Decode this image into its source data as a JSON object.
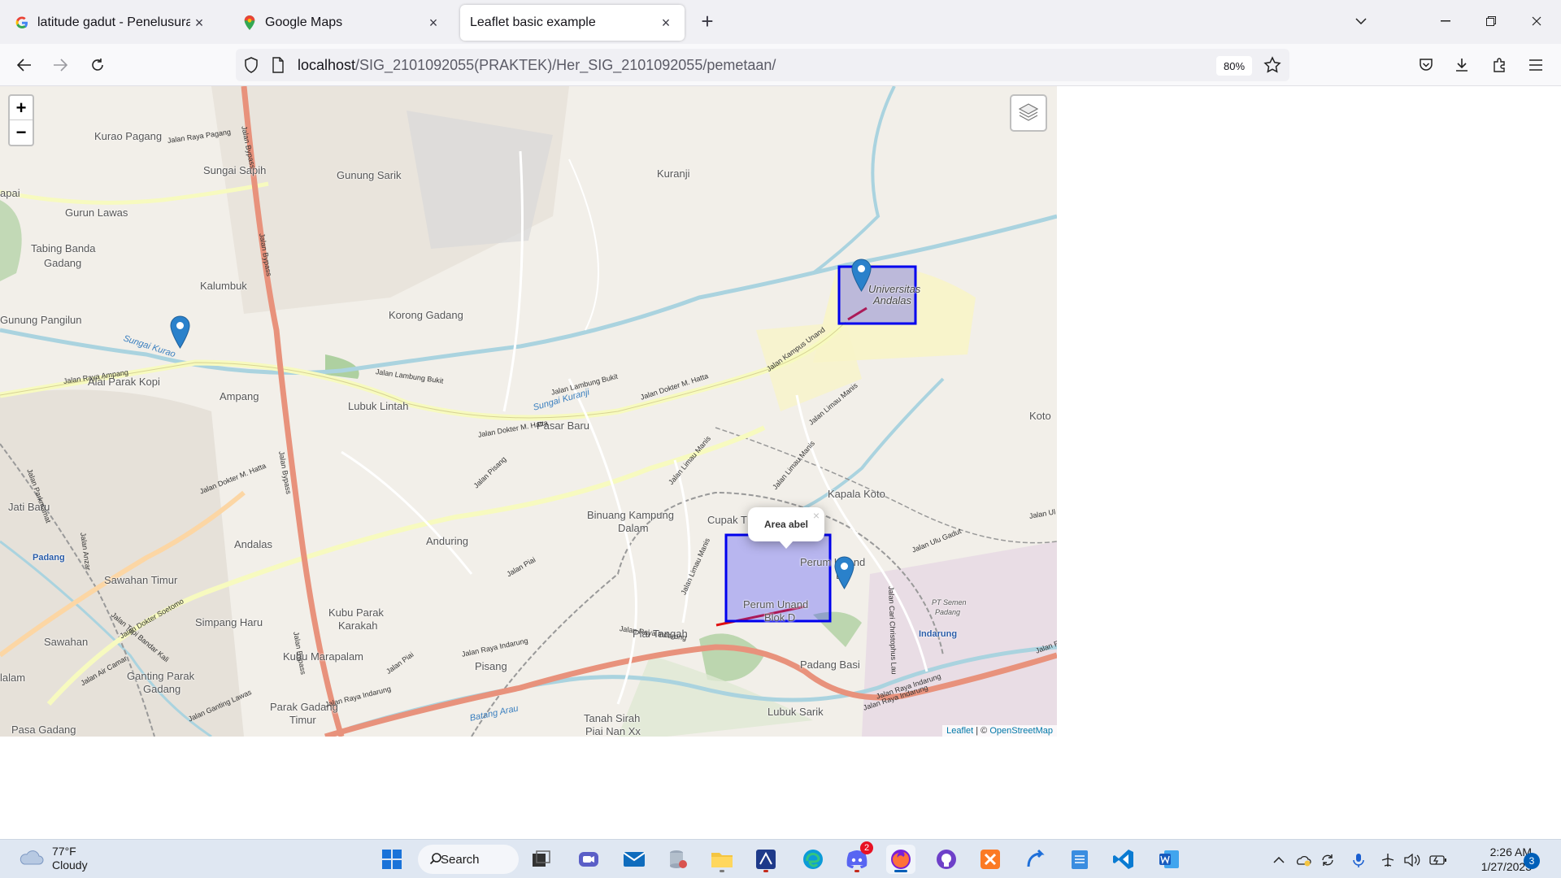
{
  "browser": {
    "tabs": [
      {
        "label": "latitude gadut - Penelusuran Goo",
        "icon": "google-icon"
      },
      {
        "label": "Google Maps",
        "icon": "google-maps-icon"
      },
      {
        "label": "Leaflet basic example",
        "icon": "none"
      }
    ],
    "url_host": "localhost",
    "url_path": "/SIG_2101092055(PRAKTEK)/Her_SIG_2101092055/pemetaan/",
    "zoom": "80%"
  },
  "map": {
    "zoom_in": "+",
    "zoom_out": "−",
    "popup_text": "Area abel",
    "popup_close": "×",
    "attribution_leaflet": "Leaflet",
    "attribution_sep": " | © ",
    "attribution_osm": "OpenStreetMap",
    "places": [
      "Kurao Pagang",
      "Sungai Sapih",
      "Gunung Sarik",
      "Kuranji",
      "Gurun Lawas",
      "Tabing Banda",
      "Gadang",
      "Kalumbuk",
      "Gunung Pangilun",
      "Korong Gadang",
      "Universitas",
      "Andalas",
      "Alai Parak Kopi",
      "Ampang",
      "Lubuk Lintah",
      "Pasar Baru",
      "Koto",
      "Jati Baru",
      "Kapala Koto",
      "Binuang Kampung",
      "Dalam",
      "Cupak T",
      "Anduring",
      "Andalas",
      "Padang",
      "Sawahan Timur",
      "Perum Unand",
      "Bl",
      "Kubu Parak",
      "Karakah",
      "Simpang Haru",
      "Perum Unand",
      "Blok D",
      "Piai Tangah",
      "Indarung",
      "Sawahan",
      "Kubu Marapalam",
      "Pisang",
      "Padang Basi",
      "Ganting Parak",
      "Gadang",
      "Parak Gadang",
      "Timur",
      "lalam",
      "Lubuk Sarik",
      "Tanah Sirah",
      "Piai Nan Xx",
      "Pasa Gadang",
      "apai",
      "PT Semen",
      "Padang"
    ],
    "roads": [
      "Jalan Raya Pagang",
      "Jalan Bypass",
      "Jalan Bypass",
      "Jalan Raya Ampang",
      "Jalan Lambung Bukit",
      "Jalan Lambung Bukit",
      "Jalan Dokter M. Hatta",
      "Sungai Kuranji",
      "Jalan Dokter M. Hatta",
      "Jalan Kampus Unand",
      "Jalan Limau Manis",
      "Jalan Dokter M. Hatta",
      "Jalan Pisang",
      "Jalan Limau Manis",
      "Jalan Limau Manis",
      "Jalan Bypass",
      "Jalan Raya Indarung",
      "Jalan Raya Indarung",
      "Jalan Limau Manis",
      "Jalan Ulu Gadut",
      "Jalan Cari Christophus Lau",
      "Jalan Raya Indarung",
      "Jalan Piai",
      "Jalan Raya Indarung",
      "Jalan Piai",
      "Jalan Bypass",
      "Jalan Tepi Bandar Kali",
      "Jalan Dokter Soetomo",
      "Jalan Air Camar",
      "Batang Arau",
      "Jalan Ganting Lawas",
      "Sungai Kurao",
      "Jalan Raya Indarung",
      "Jalan Ul",
      "Jalan Raya",
      "Jalan Anzar",
      "Jalan Parkmamat"
    ]
  },
  "taskbar": {
    "temp": "77°F",
    "condition": "Cloudy",
    "search_label": "Search",
    "discord_badge": "2",
    "time": "2:26 AM",
    "date": "1/27/2023",
    "notifications": "3"
  }
}
